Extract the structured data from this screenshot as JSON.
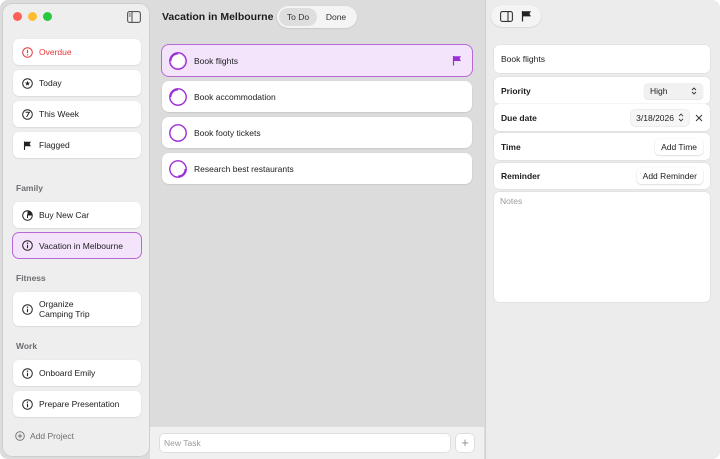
{
  "sidebar": {
    "smart_lists": [
      {
        "label": "Overdue",
        "icon": "exclamation-circle-icon"
      },
      {
        "label": "Today",
        "icon": "star-circle-icon"
      },
      {
        "label": "This Week",
        "icon": "clock-circle-icon"
      },
      {
        "label": "Flagged",
        "icon": "flag-icon"
      }
    ],
    "groups": [
      {
        "title": "Family",
        "projects": [
          {
            "label": "Buy New Car"
          },
          {
            "label": "Vacation in Melbourne"
          }
        ]
      },
      {
        "title": "Fitness",
        "projects": [
          {
            "label": "Organize\nCamping Trip"
          }
        ]
      },
      {
        "title": "Work",
        "projects": [
          {
            "label": "Onboard Emily"
          },
          {
            "label": "Prepare Presentation"
          }
        ]
      }
    ],
    "add_project_label": "Add Project",
    "selected_project": "Vacation in Melbourne"
  },
  "main": {
    "title": "Vacation in Melbourne",
    "tabs": [
      {
        "label": "To Do",
        "active": true
      },
      {
        "label": "Done",
        "active": false
      }
    ],
    "tasks": [
      {
        "label": "Book flights",
        "flagged": true,
        "selected": true,
        "progress": 0.25
      },
      {
        "label": "Book accommodation",
        "flagged": false,
        "selected": false,
        "progress": 0.25
      },
      {
        "label": "Book footy tickets",
        "flagged": false,
        "selected": false,
        "progress": 0
      },
      {
        "label": "Research best restaurants",
        "flagged": false,
        "selected": false,
        "progress": 0.25
      }
    ],
    "new_task_placeholder": "New Task",
    "add_button_label": "+"
  },
  "inspector": {
    "task_title": "Book flights",
    "priority": {
      "label": "Priority",
      "value": "High"
    },
    "due_date": {
      "label": "Due date",
      "value": "3/18/2026"
    },
    "time": {
      "label": "Time",
      "button": "Add Time"
    },
    "reminder": {
      "label": "Reminder",
      "button": "Add Reminder"
    },
    "notes_placeholder": "Notes"
  },
  "colors": {
    "accent": "#9b2fd6",
    "selected_bg": "#f3e3fb",
    "danger": "#e8363a"
  }
}
